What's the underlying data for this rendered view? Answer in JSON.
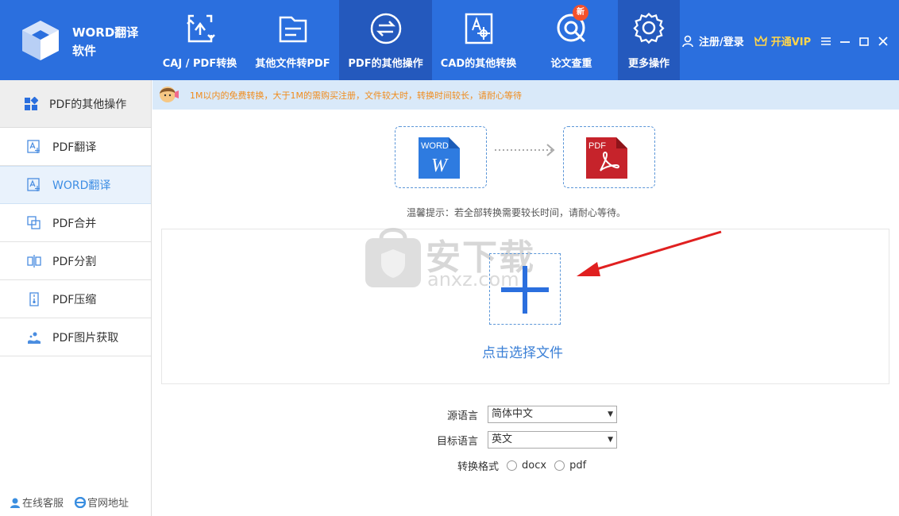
{
  "app": {
    "title_line1": "WORD翻译",
    "title_line2": "软件"
  },
  "nav": [
    {
      "label": "CAJ / PDF转换",
      "icon": "caj-pdf-convert-icon"
    },
    {
      "label": "其他文件转PDF",
      "icon": "folder-icon"
    },
    {
      "label": "PDF的其他操作",
      "icon": "exchange-icon"
    },
    {
      "label": "CAD的其他转换",
      "icon": "cad-icon"
    },
    {
      "label": "论文查重",
      "icon": "check-icon"
    },
    {
      "label": "更多操作",
      "icon": "gear-icon"
    }
  ],
  "badge_new": "新",
  "header_right": {
    "register_login": "注册/登录",
    "vip": "开通VIP"
  },
  "sidebar": {
    "header": "PDF的其他操作",
    "items": [
      {
        "label": "PDF翻译",
        "icon": "translate-icon"
      },
      {
        "label": "WORD翻译",
        "icon": "translate-icon"
      },
      {
        "label": "PDF合并",
        "icon": "merge-icon"
      },
      {
        "label": "PDF分割",
        "icon": "split-icon"
      },
      {
        "label": "PDF压缩",
        "icon": "compress-icon"
      },
      {
        "label": "PDF图片获取",
        "icon": "image-extract-icon"
      }
    ],
    "footer": {
      "online_service": "在线客服",
      "official_site": "官网地址"
    }
  },
  "notice": "1M以内的免费转换，大于1M的需购买注册，文件较大时，转换时间较长，请耐心等待",
  "conversion": {
    "from_tag": "WORD",
    "from_letter": "W",
    "to_tag": "PDF"
  },
  "tip": "温馨提示：若全部转换需要较长时间，请耐心等待。",
  "watermark": {
    "text": "安下载",
    "domain": "anxz.com"
  },
  "choose_file": "点击选择文件",
  "form": {
    "source_label": "源语言",
    "source_value": "简体中文",
    "target_label": "目标语言",
    "target_value": "英文",
    "format_label": "转换格式",
    "format_options": [
      "docx",
      "pdf"
    ]
  },
  "colors": {
    "header_bg": "#2b6fde",
    "header_active": "#2459bd",
    "accent_blue": "#3a7fd6",
    "notice_text": "#f08c1d",
    "vip": "#ffd54a",
    "arrow_red": "#e02020"
  }
}
